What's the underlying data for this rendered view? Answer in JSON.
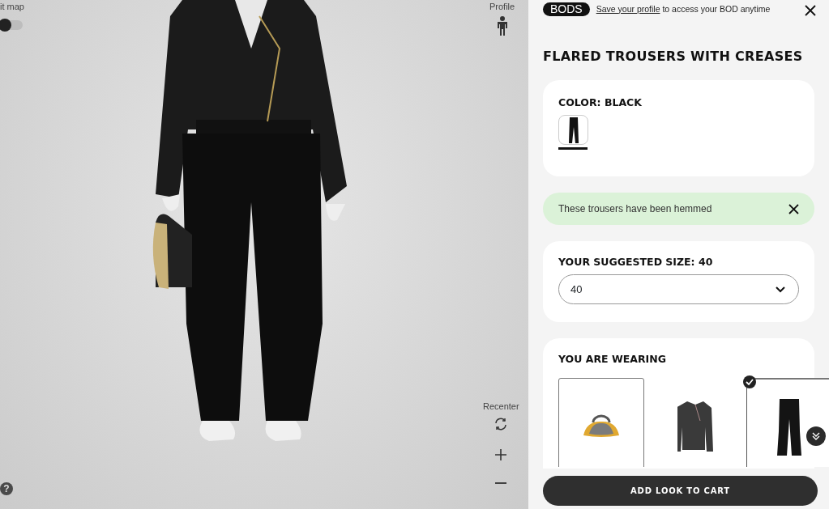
{
  "viewer": {
    "fit_map": {
      "label": "it map",
      "on": false
    },
    "profile_label": "Profile",
    "recenter_label": "Recenter",
    "help": "?"
  },
  "panel": {
    "badge": "BODS",
    "notice": {
      "link": "Save your profile",
      "rest": "to access your BOD anytime"
    },
    "title": "FLARED TROUSERS WITH CREASES",
    "color": {
      "label": "COLOR: BLACK",
      "swatches": [
        {
          "selected": true
        }
      ]
    },
    "alert": {
      "text": "These trousers have been hemmed"
    },
    "size": {
      "label": "YOUR SUGGESTED SIZE: 40",
      "value": "40"
    },
    "wearing": {
      "title": "YOU ARE WEARING",
      "items": [
        {
          "kind": "bag",
          "selected": true,
          "checked": false
        },
        {
          "kind": "jacket",
          "selected": false,
          "checked": false
        },
        {
          "kind": "trousers",
          "selected": false,
          "checked": true
        }
      ]
    },
    "cart_button": "ADD LOOK TO CART"
  }
}
